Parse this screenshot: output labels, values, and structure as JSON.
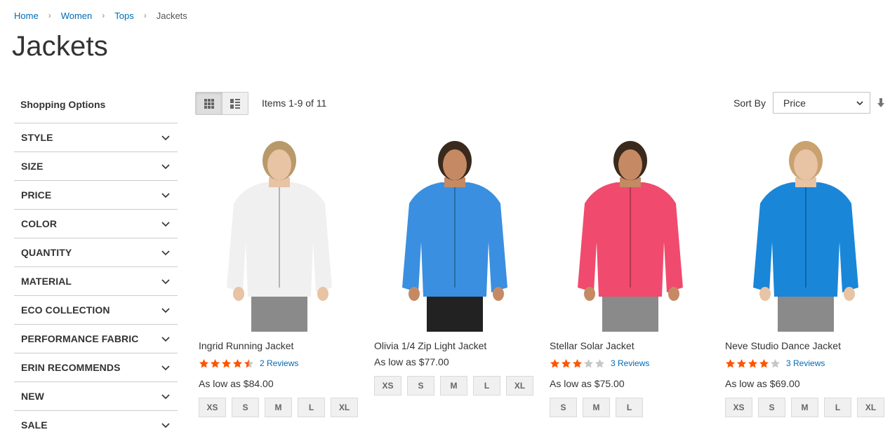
{
  "breadcrumbs": [
    {
      "label": "Home"
    },
    {
      "label": "Women"
    },
    {
      "label": "Tops"
    },
    {
      "label": "Jackets"
    }
  ],
  "page_title": "Jackets",
  "sidebar": {
    "title": "Shopping Options",
    "filters": [
      {
        "label": "STYLE"
      },
      {
        "label": "SIZE"
      },
      {
        "label": "PRICE"
      },
      {
        "label": "COLOR"
      },
      {
        "label": "QUANTITY"
      },
      {
        "label": "MATERIAL"
      },
      {
        "label": "ECO COLLECTION"
      },
      {
        "label": "PERFORMANCE FABRIC"
      },
      {
        "label": "ERIN RECOMMENDS"
      },
      {
        "label": "NEW"
      },
      {
        "label": "SALE"
      }
    ]
  },
  "toolbar": {
    "amount": "Items 1-9 of 11",
    "sort_label": "Sort By",
    "sort_value": "Price",
    "view_modes": [
      "grid",
      "list"
    ],
    "active_view": "grid"
  },
  "colors": {
    "link": "#006bb4",
    "star_filled": "#ff5501",
    "star_empty": "#c7c7c7"
  },
  "products": [
    {
      "name": "Ingrid Running Jacket",
      "rating": 4.5,
      "reviews": "2 Reviews",
      "price": "As low as $84.00",
      "sizes": [
        "XS",
        "S",
        "M",
        "L",
        "XL"
      ],
      "jacket_color": "#f0f0f0"
    },
    {
      "name": "Olivia 1/4 Zip Light Jacket",
      "rating": null,
      "reviews": null,
      "price": "As low as $77.00",
      "sizes": [
        "XS",
        "S",
        "M",
        "L",
        "XL"
      ],
      "jacket_color": "#3a8fe0"
    },
    {
      "name": "Stellar Solar Jacket",
      "rating": 3,
      "reviews": "3 Reviews",
      "price": "As low as $75.00",
      "sizes": [
        "S",
        "M",
        "L"
      ],
      "jacket_color": "#f04a6e"
    },
    {
      "name": "Neve Studio Dance Jacket",
      "rating": 4,
      "reviews": "3 Reviews",
      "price": "As low as $69.00",
      "sizes": [
        "XS",
        "S",
        "M",
        "L",
        "XL"
      ],
      "jacket_color": "#1a86d8"
    }
  ]
}
